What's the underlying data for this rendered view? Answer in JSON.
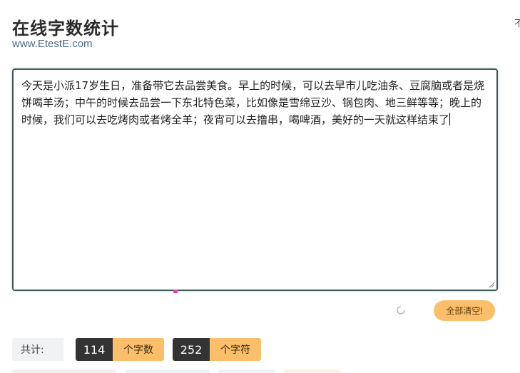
{
  "header": {
    "title": "在线字数统计",
    "site": "www.EtestE.com",
    "corner_glyph": "不"
  },
  "editor": {
    "text": "今天是小派17岁生日，准备带它去品尝美食。早上的时候，可以去早市儿吃油条、豆腐脑或者是烧饼喝羊汤；中午的时候去品尝一下东北特色菜，比如像是雪绵豆沙、锅包肉、地三鲜等等；晚上的时候，我们可以去吃烤肉或者烤全羊；夜宵可以去撸串，喝啤酒，美好的一天就这样结束了"
  },
  "actions": {
    "clear_label": "全部清空!"
  },
  "stats": {
    "total_label": "共计:",
    "char_count": "114",
    "char_unit": "个字数",
    "symbol_count": "252",
    "symbol_unit": "个字符"
  },
  "colors": {
    "accent": "#fbbf6b",
    "dark": "#333333",
    "border": "#3d5a5a",
    "link": "#4a6a8a"
  }
}
